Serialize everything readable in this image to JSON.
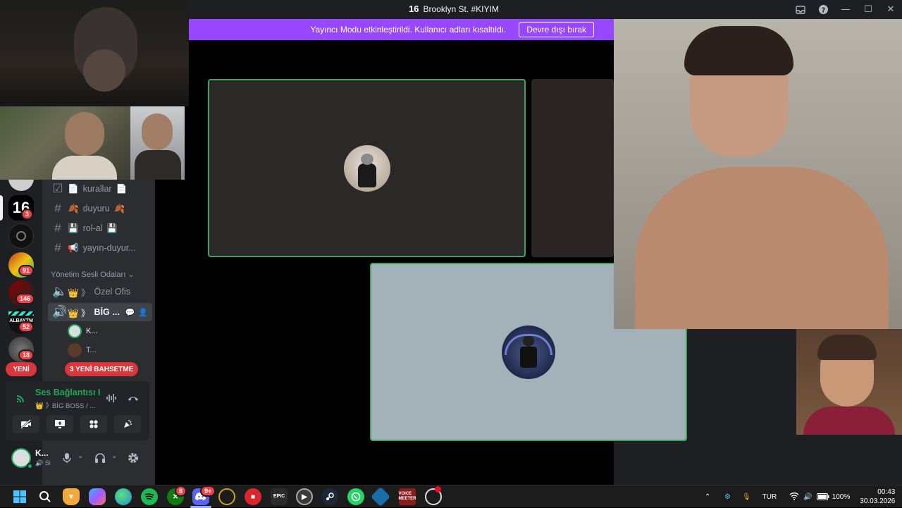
{
  "window": {
    "title": "Brooklyn St. #KIYIM",
    "logo_text": "16"
  },
  "banner": {
    "message": "Yayıncı Modu etkinleştirildi. Kullanıcı adları kısaltıldı.",
    "disable_label": "Devre dışı bırak"
  },
  "servers": {
    "badges": [
      "3",
      "91",
      "146",
      "52",
      "18"
    ],
    "new_label": "YENİ"
  },
  "channels": {
    "items": [
      {
        "name": "kurallar",
        "emoji_left": "📄",
        "emoji_right": "📄"
      },
      {
        "name": "duyuru",
        "emoji_left": "🍂",
        "emoji_right": "🍂"
      },
      {
        "name": "rol-al",
        "emoji_left": "💾",
        "emoji_right": "💾"
      },
      {
        "name": "yayın-duyur...",
        "emoji_left": "📢",
        "emoji_right": ""
      }
    ],
    "category": "Yönetim Sesli Odaları",
    "voice": [
      {
        "name": "Özel Ofis",
        "prefix": "👑 》"
      },
      {
        "name": "BİG ...",
        "prefix": "👑 》"
      }
    ],
    "members": [
      "K...",
      "T..."
    ],
    "new_mentions": "3 YENİ BAHSETME"
  },
  "voice_panel": {
    "status": "Ses Bağlantısı Kuruldu",
    "channel": "👑 》BİG BOSS / ..."
  },
  "user": {
    "name": "K...",
    "status": "Si"
  },
  "taskbar": {
    "language": "TUR",
    "battery": "100%",
    "time": "00:43",
    "date": "30.03.2026",
    "badges": {
      "xbox": "8",
      "discord": "9+"
    },
    "epic_label": "EPIC",
    "voicemeeter_label": "VOICE MEETER"
  }
}
